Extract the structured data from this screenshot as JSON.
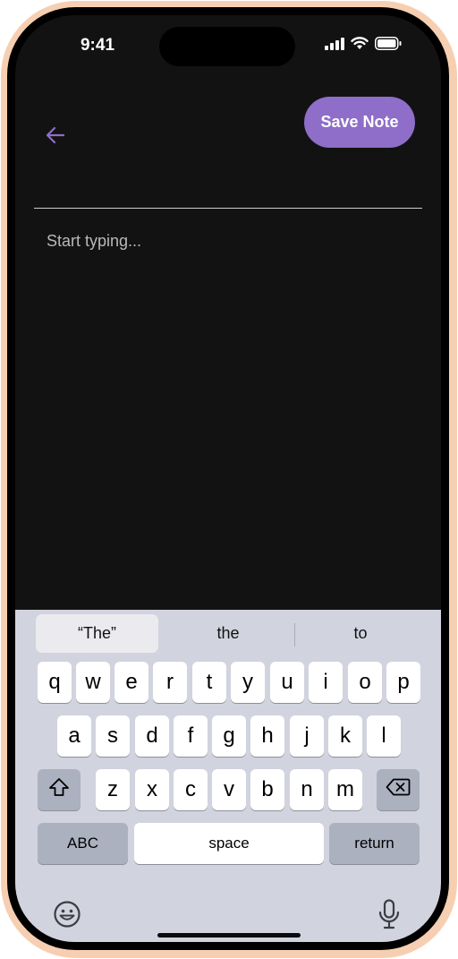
{
  "status_bar": {
    "time": "9:41",
    "icons": [
      "cellular-signal-icon",
      "wifi-icon",
      "battery-icon"
    ]
  },
  "header": {
    "back_icon": "arrow-left-icon",
    "save_label": "Save Note"
  },
  "editor": {
    "title_value": "",
    "body_placeholder": "Start typing..."
  },
  "keyboard": {
    "suggestions": [
      "“The”",
      "the",
      "to"
    ],
    "row1": [
      "q",
      "w",
      "e",
      "r",
      "t",
      "y",
      "u",
      "i",
      "o",
      "p"
    ],
    "row2": [
      "a",
      "s",
      "d",
      "f",
      "g",
      "h",
      "j",
      "k",
      "l"
    ],
    "row3": [
      "z",
      "x",
      "c",
      "v",
      "b",
      "n",
      "m"
    ],
    "abc_label": "ABC",
    "space_label": "space",
    "return_label": "return",
    "shift_icon": "shift-icon",
    "delete_icon": "backspace-icon",
    "emoji_icon": "emoji-icon",
    "mic_icon": "microphone-icon"
  },
  "colors": {
    "accent": "#8e6ec8",
    "background": "#131213",
    "keyboard": "#d1d3de",
    "frame": "#f6cfb2"
  }
}
